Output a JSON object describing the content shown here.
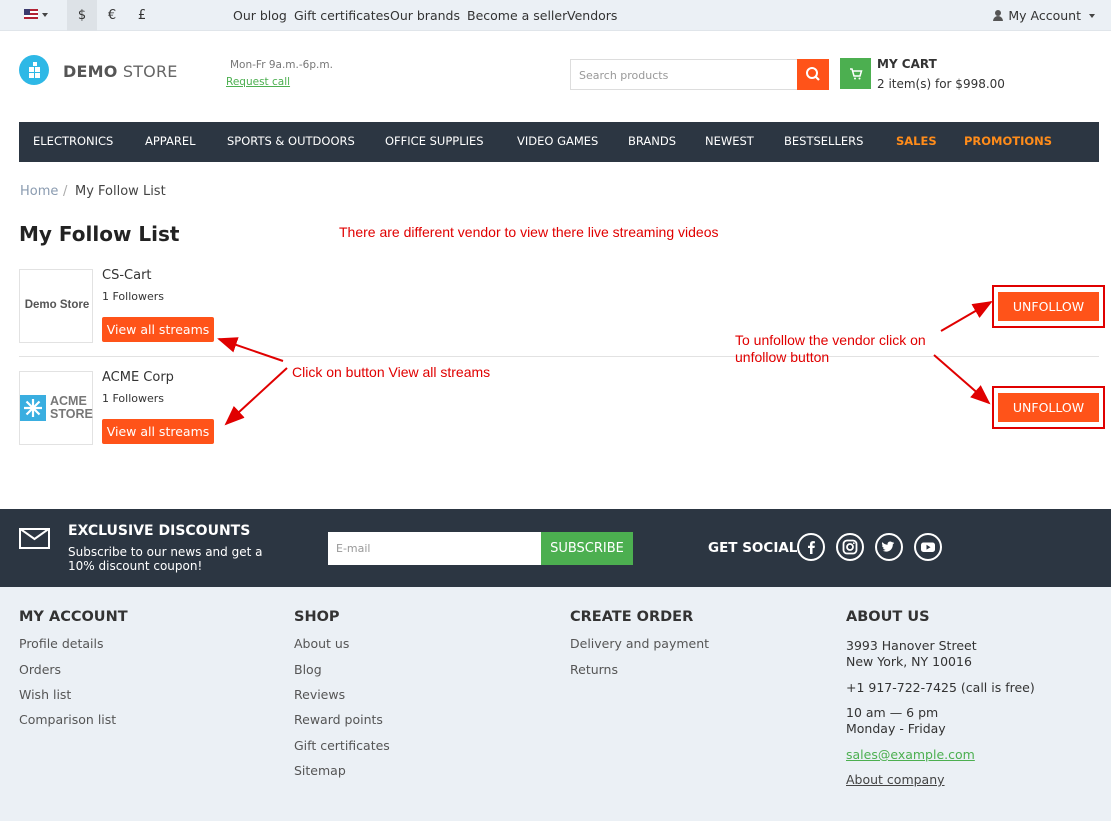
{
  "topbar": {
    "currencies": [
      "$",
      "€",
      "£"
    ],
    "links": [
      "Our blog",
      "Gift certificates",
      "Our brands",
      "Become a seller",
      "Vendors"
    ],
    "account": "My Account"
  },
  "header": {
    "logo_bold": "DEMO",
    "logo_light": "STORE",
    "hours": "Mon-Fr 9a.m.-6p.m.",
    "request_call": "Request call",
    "search_placeholder": "Search products",
    "cart_title": "MY CART",
    "cart_summary": "2 item(s) for $998.00"
  },
  "nav": [
    "ELECTRONICS",
    "APPAREL",
    "SPORTS & OUTDOORS",
    "OFFICE SUPPLIES",
    "VIDEO GAMES",
    "BRANDS",
    "NEWEST",
    "BESTSELLERS",
    "SALES",
    "PROMOTIONS"
  ],
  "breadcrumb": {
    "home": "Home",
    "sep": "/",
    "current": "My Follow List"
  },
  "page_title": "My Follow List",
  "annotations": {
    "top": "There are different vendor to view there live streaming videos",
    "streams": "Click on button View all streams",
    "unfollow_line1": "To unfollow the vendor click on",
    "unfollow_line2": "unfollow button"
  },
  "vendors": [
    {
      "name": "CS-Cart",
      "followers": "1 Followers",
      "logo_text": "Demo Store",
      "streams_label": "View all streams",
      "unfollow_label": "UNFOLLOW"
    },
    {
      "name": "ACME Corp",
      "followers": "1 Followers",
      "logo_text1": "ACME",
      "logo_text2": "STORE",
      "streams_label": "View all streams",
      "unfollow_label": "UNFOLLOW"
    }
  ],
  "subscribe": {
    "title": "EXCLUSIVE DISCOUNTS",
    "text": "Subscribe to our news and get a 10% discount coupon!",
    "email_placeholder": "E-mail",
    "button": "SUBSCRIBE",
    "social_title": "GET SOCIAL",
    "social_icons": [
      "facebook-icon",
      "instagram-icon",
      "twitter-icon",
      "youtube-icon"
    ]
  },
  "footer": {
    "my_account": {
      "title": "MY ACCOUNT",
      "links": [
        "Profile details",
        "Orders",
        "Wish list",
        "Comparison list"
      ]
    },
    "shop": {
      "title": "SHOP",
      "links": [
        "About us",
        "Blog",
        "Reviews",
        "Reward points",
        "Gift certificates",
        "Sitemap"
      ]
    },
    "create_order": {
      "title": "CREATE ORDER",
      "links": [
        "Delivery and payment",
        "Returns"
      ]
    },
    "about": {
      "title": "ABOUT US",
      "address1": "3993 Hanover Street",
      "address2": "New York, NY 10016",
      "phone": "+1 917-722-7425 (call is free)",
      "hours1": "10 am — 6 pm",
      "hours2": "Monday - Friday",
      "email": "sales@example.com",
      "about_company": "About company"
    }
  },
  "colors": {
    "accent": "#ff5319",
    "green": "#4caf50",
    "dark": "#2c3642",
    "annotation": "#e00000"
  }
}
